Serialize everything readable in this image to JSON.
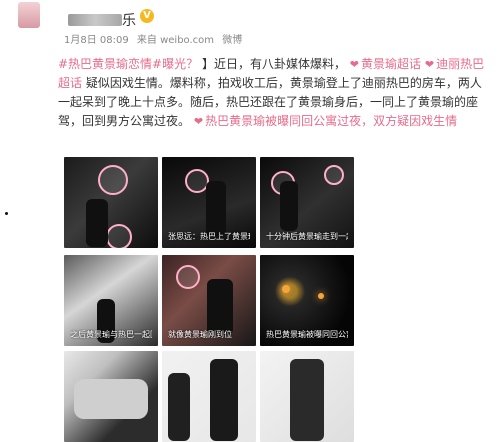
{
  "user": {
    "name": "乐",
    "verified_badge": "V",
    "timestamp": "1月8日 08:09",
    "source": "来自 weibo.com",
    "tag": "微博"
  },
  "post": {
    "hashtag_main": "#热巴黄景瑜恋情#曝光？",
    "intro": "】近日，有八卦媒体爆料，",
    "tag1": "黄景瑜超话",
    "tag2": "迪丽热巴超话",
    "body": "疑似因戏生情。爆料称，拍戏收工后，黄景瑜登上了迪丽热巴的房车，两人一起呆到了晚上十点多。随后，热巴还跟在了黄景瑜身后，一同上了黄景瑜的座驾，回到男方公寓过夜。",
    "tag3": "热巴黄景瑜被曝同回公寓过夜，双方疑因戏生情"
  },
  "photos": [
    {
      "caption": ""
    },
    {
      "caption": "张思远：热巴上了黄景瑜的车"
    },
    {
      "caption": "十分钟后黄景瑜走到一起再说话"
    },
    {
      "caption": "之后黄景瑜与热巴一起回家"
    },
    {
      "caption": "就像黄景瑜刚到位"
    },
    {
      "caption": "热巴黄景瑜被曝同回公寓"
    },
    {
      "caption": ""
    },
    {
      "caption": ""
    },
    {
      "caption": ""
    }
  ]
}
